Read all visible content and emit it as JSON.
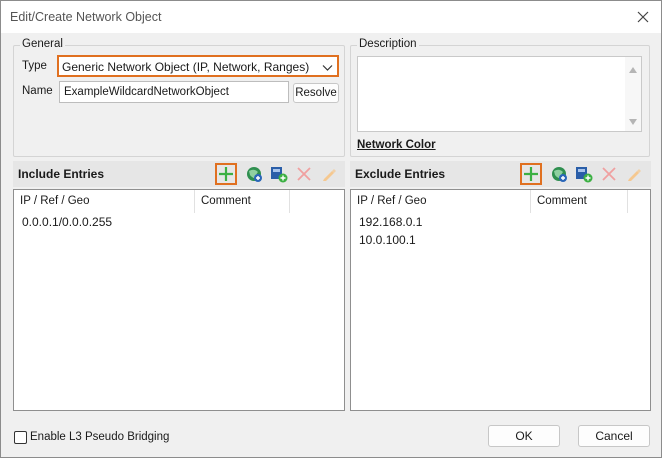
{
  "window": {
    "title": "Edit/Create Network Object"
  },
  "general": {
    "group_label": "General",
    "type_label": "Type",
    "type_value": "Generic Network Object (IP, Network, Ranges)",
    "name_label": "Name",
    "name_value": "ExampleWildcardNetworkObject",
    "resolve_button": "Resolve"
  },
  "description": {
    "group_label": "Description",
    "value": "",
    "network_color_link": "Network Color"
  },
  "include": {
    "title": "Include Entries",
    "columns": [
      "IP / Ref / Geo",
      "Comment"
    ],
    "rows": [
      "0.0.0.1/0.0.0.255"
    ]
  },
  "exclude": {
    "title": "Exclude Entries",
    "columns": [
      "IP / Ref / Geo",
      "Comment"
    ],
    "rows": [
      "192.168.0.1",
      "10.0.100.1"
    ]
  },
  "toolbar_icons": [
    "add-icon",
    "globe-icon",
    "add-reference-icon",
    "delete-icon",
    "edit-icon"
  ],
  "footer": {
    "checkbox_label": "Enable L3 Pseudo Bridging",
    "checkbox_checked": false,
    "ok_button": "OK",
    "cancel_button": "Cancel"
  },
  "colors": {
    "highlight": "#e07020",
    "add_green": "#3cb043",
    "delete_red": "#e04545",
    "edit_orange": "#f0a030"
  }
}
